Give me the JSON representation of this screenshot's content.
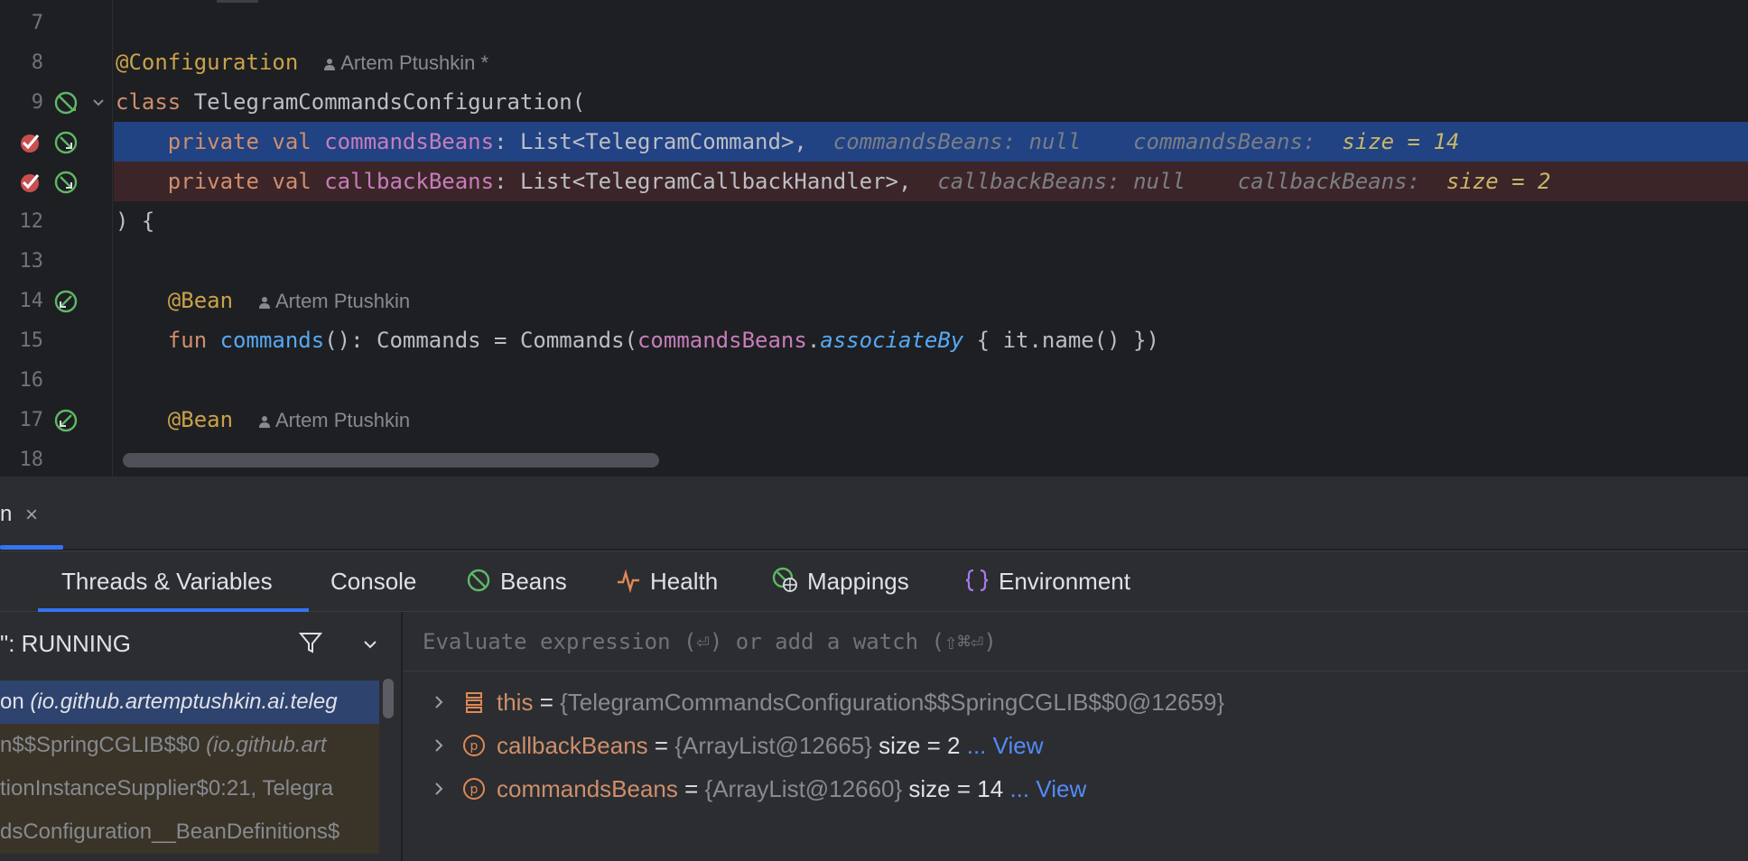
{
  "editor": {
    "lines": [
      {
        "n": "7"
      },
      {
        "n": "8",
        "annotation": "@Configuration",
        "author": "Artem Ptushkin *"
      },
      {
        "n": "9",
        "kw": "class",
        "name": "TelegramCommandsConfiguration("
      },
      {
        "n": "",
        "kw1": "private",
        "kw2": "val",
        "prop": "commandsBeans",
        "type": ": List<TelegramCommand>,",
        "inline_hint": "commandsBeans: null",
        "inline_label": "commandsBeans:",
        "inline_value": "size = 14"
      },
      {
        "n": "",
        "kw1": "private",
        "kw2": "val",
        "prop": "callbackBeans",
        "type": ": List<TelegramCallbackHandler>,",
        "inline_hint": "callbackBeans: null",
        "inline_label": "callbackBeans:",
        "inline_value": "size = 2"
      },
      {
        "n": "12",
        "text": ") {"
      },
      {
        "n": "13"
      },
      {
        "n": "14",
        "annotation": "@Bean",
        "author": "Artem Ptushkin"
      },
      {
        "n": "15",
        "kw": "fun",
        "fn": "commands",
        "mid": "(): Commands = Commands(",
        "prop": "commandsBeans",
        "dot": ".",
        "call": "associateBy",
        "tail": " { it.name() })"
      },
      {
        "n": "16"
      },
      {
        "n": "17",
        "annotation": "@Bean",
        "author": "Artem Ptushkin"
      },
      {
        "n": "18"
      }
    ]
  },
  "tool_window": {
    "title": "n",
    "close_glyph": "×",
    "tabs": [
      {
        "label": "Threads & Variables",
        "icon": null
      },
      {
        "label": "Console",
        "icon": null
      },
      {
        "label": "Beans",
        "icon": "bean-icon"
      },
      {
        "label": "Health",
        "icon": "health-icon"
      },
      {
        "label": "Mappings",
        "icon": "mappings-icon"
      },
      {
        "label": "Environment",
        "icon": "environment-icon"
      }
    ],
    "thread_status": "\": RUNNING",
    "frames": [
      {
        "main": "on ",
        "pkg": "(io.github.artemptushkin.ai.teleg"
      },
      {
        "main": "n$$SpringCGLIB$$0 ",
        "pkg": "(io.github.art"
      },
      {
        "main": "tionInstanceSupplier$0:21, Telegra",
        "pkg": ""
      },
      {
        "main": "dsConfiguration__BeanDefinitions$",
        "pkg": ""
      }
    ],
    "evaluate_placeholder": "Evaluate expression (⏎) or add a watch (⇧⌘⏎)",
    "variables": [
      {
        "name": "this",
        "value": "{TelegramCommandsConfiguration$$SpringCGLIB$$0@12659}",
        "size": "",
        "link": "",
        "icon": "field-icon"
      },
      {
        "name": "callbackBeans",
        "value": "{ArrayList@12665}",
        "size": "size = 2",
        "link": "... View",
        "icon": "parameter-icon"
      },
      {
        "name": "commandsBeans",
        "value": "{ArrayList@12660}",
        "size": "size = 14",
        "link": "... View",
        "icon": "parameter-icon"
      }
    ]
  }
}
